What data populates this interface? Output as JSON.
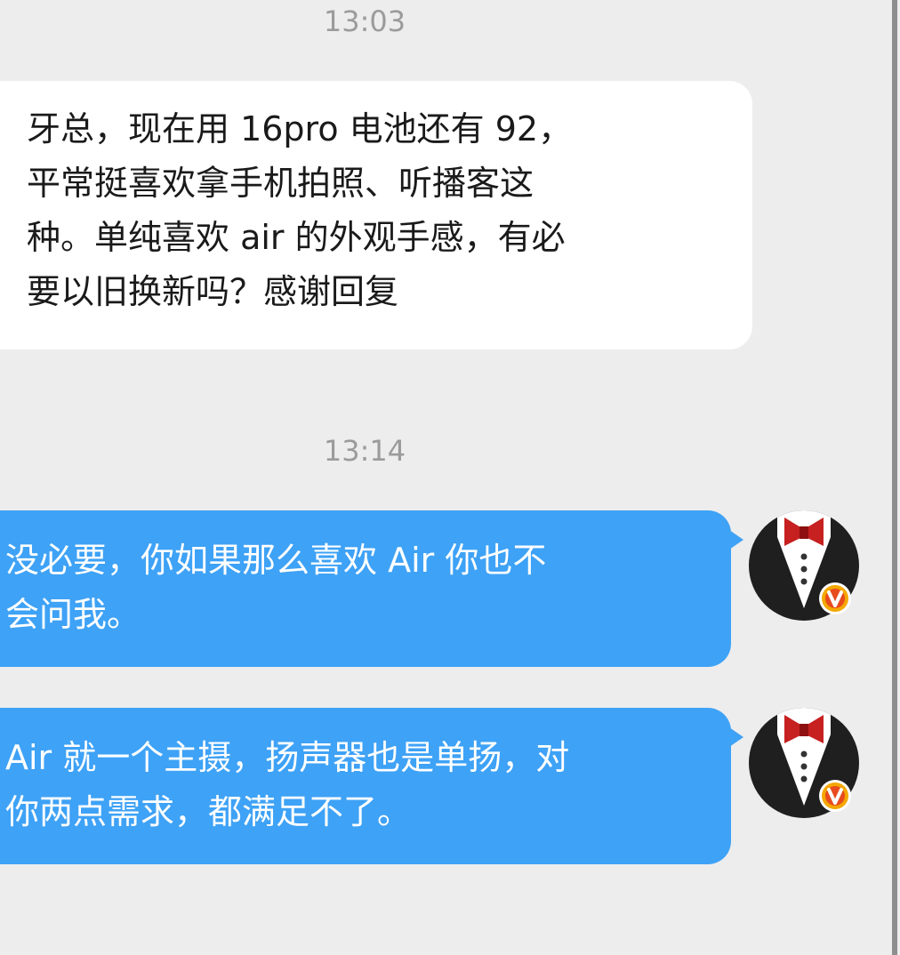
{
  "conversation": {
    "timestamps": [
      "13:03",
      "13:14"
    ],
    "messages": [
      {
        "direction": "received",
        "lines": [
          "牙总，现在用 16pro 电池还有 92，",
          "平常挺喜欢拿手机拍照、听播客这",
          "种。单纯喜欢 air 的外观手感，有必",
          "要以旧换新吗？感谢回复"
        ]
      },
      {
        "direction": "sent",
        "lines": [
          "没必要，你如果那么喜欢 Air 你也不",
          "会问我。"
        ]
      },
      {
        "direction": "sent",
        "lines": [
          "Air 就一个主摄，扬声器也是单扬，对",
          "你两点需求，都满足不了。"
        ]
      }
    ]
  },
  "avatar": {
    "icon": "tuxedo-bowtie-icon",
    "badge_icon": "vip-v-badge-icon",
    "badge_color": "#f4a800",
    "badge_inner": "#e84b1e"
  },
  "colors": {
    "background": "#ededed",
    "sent_bubble": "#3ea2f6",
    "received_bubble": "#ffffff",
    "timestamp_text": "#9b9b9b"
  }
}
